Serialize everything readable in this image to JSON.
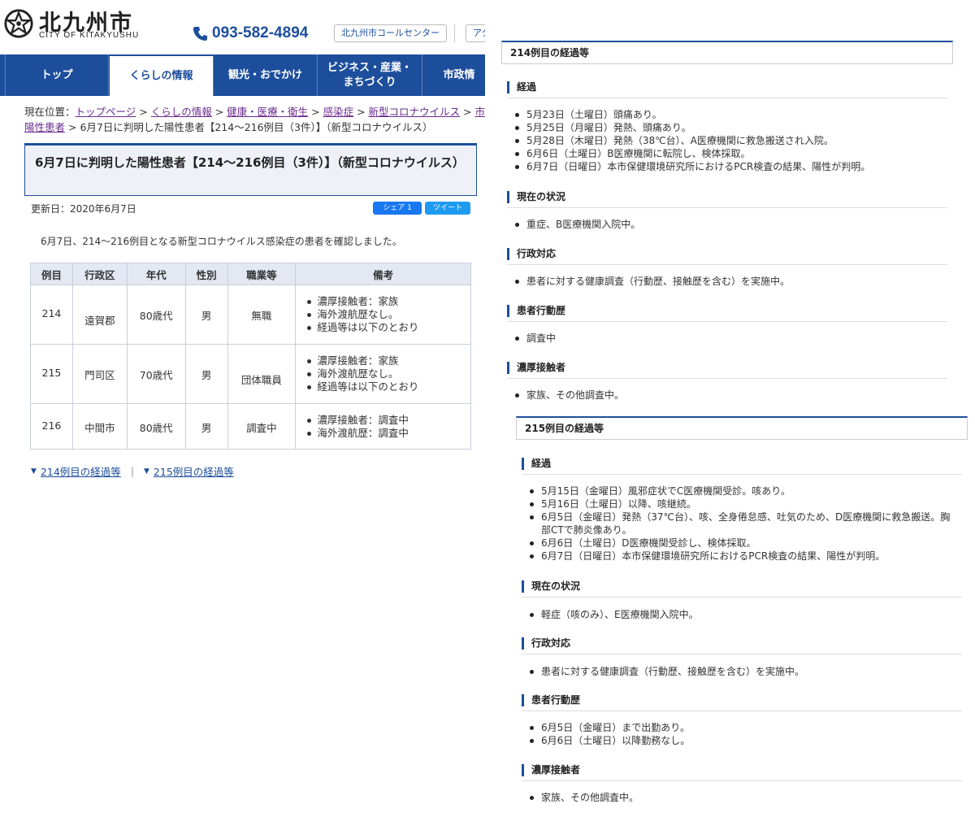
{
  "header": {
    "logo_jp": "北九州市",
    "logo_en": "CITY OF KITAKYUSHU",
    "phone": "093-582-4894",
    "callcenter_label": "北九州市コールセンター",
    "access_label": "アク"
  },
  "gnav": {
    "items": [
      {
        "label": "トップ"
      },
      {
        "label": "くらしの情報"
      },
      {
        "label": "観光・おでかけ"
      },
      {
        "label_line1": "ビジネス・産業・",
        "label_line2": "まちづくり"
      },
      {
        "label": "市政情"
      }
    ]
  },
  "breadcrumb": {
    "prefix": "現在位置：",
    "links": [
      "トップページ",
      "くらしの情報",
      "健康・医療・衛生",
      "感染症",
      "新型コロナウイルス",
      "市内で",
      "陽性患者"
    ],
    "sep": " > ",
    "current": "6月7日に判明した陽性患者【214～216例目（3件）】（新型コロナウイルス）"
  },
  "page": {
    "title": "6月7日に判明した陽性患者【214～216例目（3件）】（新型コロナウイルス）",
    "updated": "更新日：2020年6月7日",
    "share_fb": "シェア 1",
    "share_tw": "ツイート",
    "intro": "6月7日、214～216例目となる新型コロナウイルス感染症の患者を確認しました。"
  },
  "table": {
    "headers": [
      "例目",
      "行政区",
      "年代",
      "性別",
      "職業等",
      "備考"
    ],
    "rows": [
      {
        "no": "214",
        "ward": "遠賀郡",
        "age": "80歳代",
        "sex": "男",
        "job": "無職",
        "notes": [
          "濃厚接触者：家族",
          "海外渡航歴なし。",
          "経過等は以下のとおり"
        ]
      },
      {
        "no": "215",
        "ward": "門司区",
        "age": "70歳代",
        "sex": "男",
        "job": "団体職員",
        "notes": [
          "濃厚接触者：家族",
          "海外渡航歴なし。",
          "経過等は以下のとおり"
        ]
      },
      {
        "no": "216",
        "ward": "中間市",
        "age": "80歳代",
        "sex": "男",
        "job": "調査中",
        "notes": [
          "濃厚接触者：調査中",
          "海外渡航歴：調査中"
        ]
      }
    ]
  },
  "pagelinks": {
    "link1": "214例目の経過等",
    "sep": "|",
    "link2": "215例目の経過等"
  },
  "case214": {
    "title": "214例目の経過等",
    "sections": [
      {
        "heading": "経過",
        "items": [
          "5月23日（土曜日）頭痛あり。",
          "5月25日（月曜日）発熱、頭痛あり。",
          "5月28日（木曜日）発熱（38℃台）、A医療機関に救急搬送され入院。",
          "6月6日（土曜日）B医療機関に転院し、検体採取。",
          "6月7日（日曜日）本市保健環境研究所におけるPCR検査の結果、陽性が判明。"
        ]
      },
      {
        "heading": "現在の状況",
        "items": [
          "重症、B医療機関入院中。"
        ]
      },
      {
        "heading": "行政対応",
        "items": [
          "患者に対する健康調査（行動歴、接触歴を含む）を実施中。"
        ]
      },
      {
        "heading": "患者行動歴",
        "items": [
          "調査中"
        ]
      },
      {
        "heading": "濃厚接触者",
        "items": [
          "家族、その他調査中。"
        ]
      }
    ]
  },
  "case215": {
    "title": "215例目の経過等",
    "sections": [
      {
        "heading": "経過",
        "items": [
          "5月15日（金曜日）風邪症状でC医療機関受診。咳あり。",
          "5月16日（土曜日）以降、咳継続。",
          "6月5日（金曜日）発熱（37℃台）、咳、全身倦怠感、吐気のため、D医療機関に救急搬送。胸",
          "部CTで肺炎像あり。",
          "6月6日（土曜日）D医療機関受診し、検体採取。",
          "6月7日（日曜日）本市保健環境研究所におけるPCR検査の結果、陽性が判明。"
        ]
      },
      {
        "heading": "現在の状況",
        "items": [
          "軽症（咳のみ）、E医療機関入院中。"
        ]
      },
      {
        "heading": "行政対応",
        "items": [
          "患者に対する健康調査（行動歴、接触歴を含む）を実施中。"
        ]
      },
      {
        "heading": "患者行動歴",
        "items": [
          "6月5日（金曜日）まで出勤あり。",
          "6月6日（土曜日）以降勤務なし。"
        ]
      },
      {
        "heading": "濃厚接触者",
        "items": [
          "家族、その他調査中。"
        ]
      }
    ]
  },
  "colors": {
    "brand": "#1d4e9c",
    "visited_link": "#6b2c8f",
    "table_header": "#e3e8f3"
  },
  "icons": [
    "city-emblem-icon",
    "phone-icon",
    "chevron-down-icon"
  ]
}
